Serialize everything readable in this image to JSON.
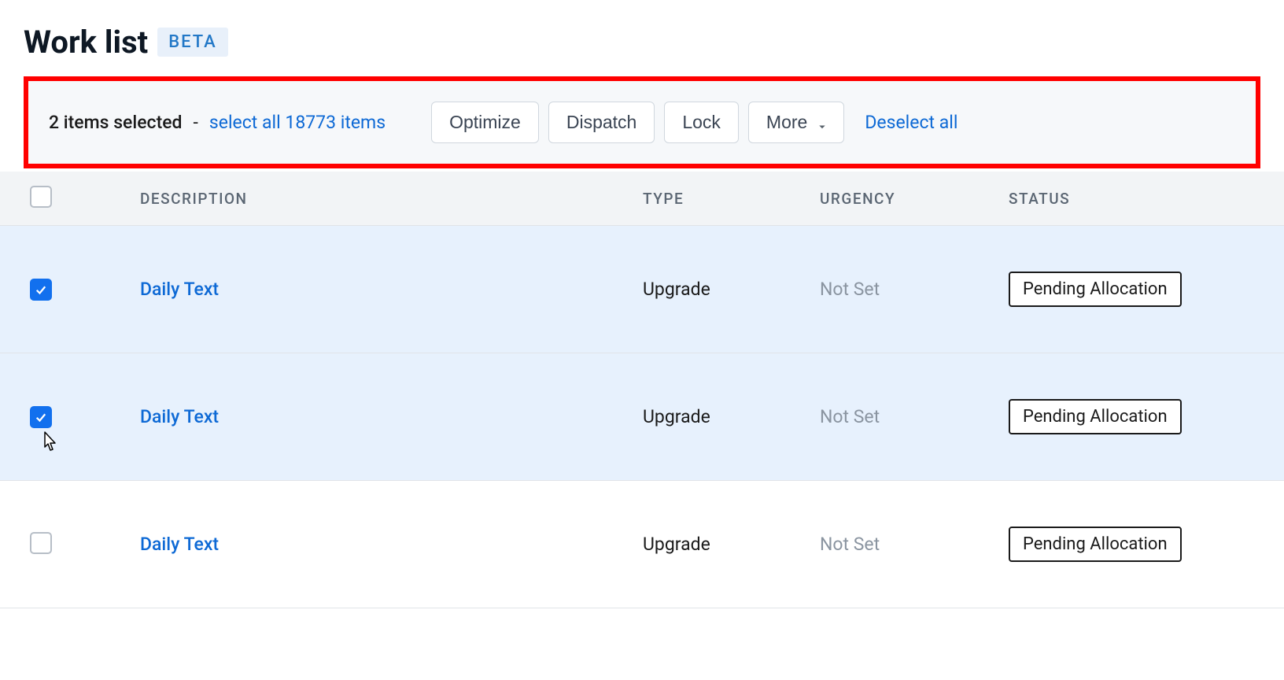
{
  "header": {
    "title": "Work list",
    "badge": "BETA"
  },
  "selectionBar": {
    "selectedText": "2 items selected",
    "selectAllLink": "select all 18773 items",
    "buttons": {
      "optimize": "Optimize",
      "dispatch": "Dispatch",
      "lock": "Lock",
      "more": "More"
    },
    "deselect": "Deselect all"
  },
  "columns": {
    "description": "DESCRIPTION",
    "type": "TYPE",
    "urgency": "URGENCY",
    "status": "STATUS"
  },
  "rows": [
    {
      "checked": true,
      "description": "Daily Text",
      "type": "Upgrade",
      "urgency": "Not Set",
      "status": "Pending Allocation"
    },
    {
      "checked": true,
      "description": "Daily Text",
      "type": "Upgrade",
      "urgency": "Not Set",
      "status": "Pending Allocation",
      "showCursor": true
    },
    {
      "checked": false,
      "description": "Daily Text",
      "type": "Upgrade",
      "urgency": "Not Set",
      "status": "Pending Allocation"
    }
  ]
}
